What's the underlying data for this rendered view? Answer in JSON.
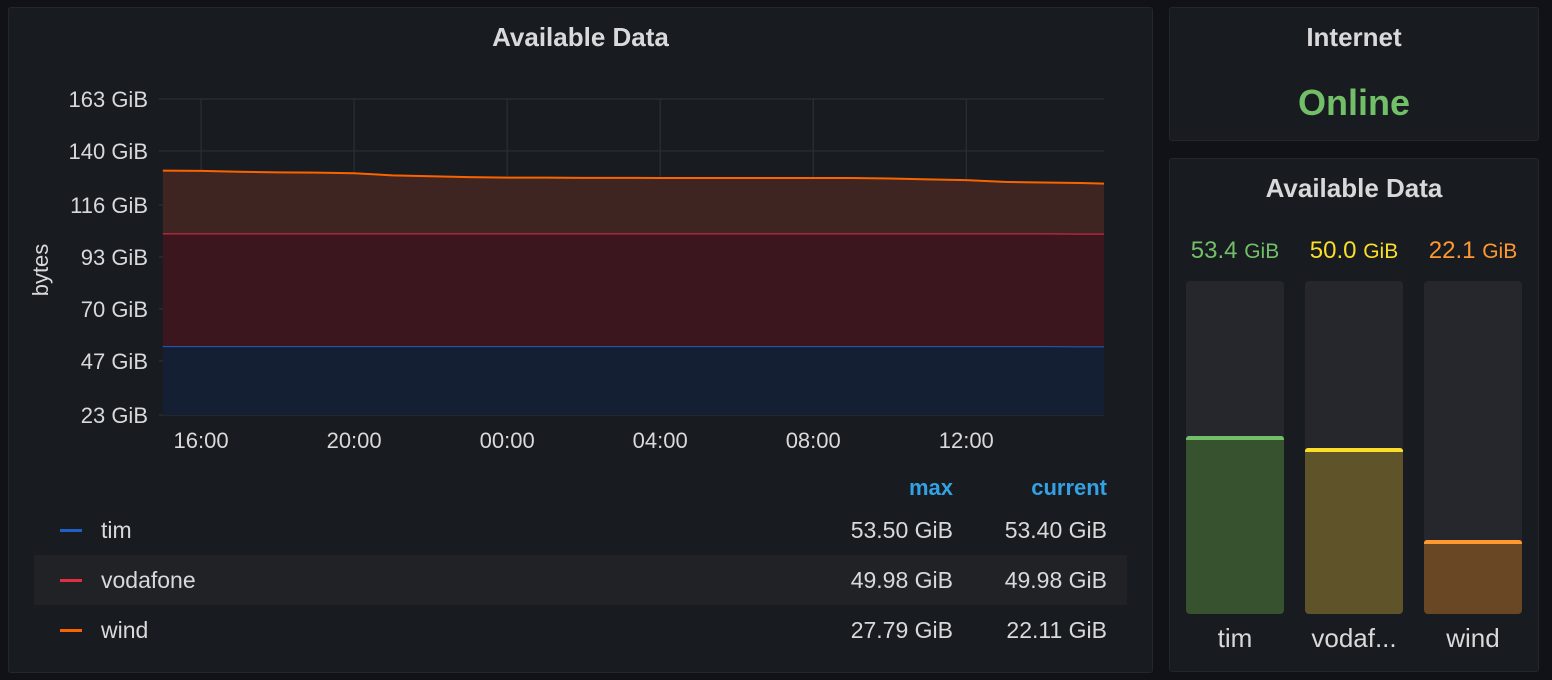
{
  "graph_panel": {
    "title": "Available Data",
    "legend": {
      "headers": {
        "max": "max",
        "current": "current"
      },
      "rows": [
        {
          "name": "tim",
          "max": "53.50 GiB",
          "current": "53.40 GiB",
          "color": "#1f60c4"
        },
        {
          "name": "vodafone",
          "max": "49.98 GiB",
          "current": "49.98 GiB",
          "color": "#e02f44"
        },
        {
          "name": "wind",
          "max": "27.79 GiB",
          "current": "22.11 GiB",
          "color": "#fa6400"
        }
      ]
    }
  },
  "chart_data": {
    "type": "area",
    "stacked": true,
    "title": "Available Data",
    "ylabel": "bytes",
    "xlabel": "",
    "ylim": [
      23,
      163
    ],
    "y_ticks": [
      "163 GiB",
      "140 GiB",
      "116 GiB",
      "93 GiB",
      "70 GiB",
      "47 GiB",
      "23 GiB"
    ],
    "y_tick_values": [
      163,
      140,
      116,
      93,
      70,
      47,
      23
    ],
    "x_ticks": [
      "16:00",
      "20:00",
      "00:00",
      "04:00",
      "08:00",
      "12:00"
    ],
    "x_tick_hours": [
      16,
      20,
      24,
      28,
      32,
      36
    ],
    "xlim_hours": [
      14.9,
      39.6
    ],
    "x_hours": [
      15,
      16,
      17,
      18,
      19,
      20,
      21,
      22,
      23,
      24,
      25,
      26,
      27,
      28,
      29,
      30,
      31,
      32,
      33,
      34,
      35,
      36,
      37,
      38,
      39,
      39.6
    ],
    "grid": true,
    "legend_placement": "bottom",
    "series": [
      {
        "name": "tim",
        "color": "#1f60c4",
        "values": [
          53.5,
          53.5,
          53.5,
          53.5,
          53.5,
          53.5,
          53.5,
          53.5,
          53.5,
          53.5,
          53.5,
          53.5,
          53.5,
          53.5,
          53.5,
          53.5,
          53.5,
          53.5,
          53.5,
          53.5,
          53.5,
          53.5,
          53.5,
          53.5,
          53.4,
          53.4
        ]
      },
      {
        "name": "vodafone",
        "color": "#e02f44",
        "values": [
          49.98,
          49.98,
          49.98,
          49.98,
          49.98,
          49.98,
          49.98,
          49.98,
          49.98,
          49.98,
          49.98,
          49.98,
          49.98,
          49.98,
          49.98,
          49.98,
          49.98,
          49.98,
          49.98,
          49.98,
          49.98,
          49.98,
          49.98,
          49.98,
          49.98,
          49.98
        ]
      },
      {
        "name": "wind",
        "color": "#fa6400",
        "values": [
          27.79,
          27.7,
          27.3,
          27.0,
          26.9,
          26.6,
          25.7,
          25.3,
          24.9,
          24.7,
          24.7,
          24.6,
          24.6,
          24.5,
          24.5,
          24.5,
          24.5,
          24.5,
          24.5,
          24.3,
          23.9,
          23.6,
          22.8,
          22.5,
          22.4,
          22.11
        ]
      }
    ]
  },
  "internet_panel": {
    "title": "Internet",
    "status": "Online",
    "status_color": "#73bf69"
  },
  "bar_panel": {
    "title": "Available Data",
    "max_value": 100,
    "bars": [
      {
        "name": "tim",
        "display_label": "tim",
        "value_number": "53.4",
        "unit": "GiB",
        "value": 53.4,
        "color": "#73bf69",
        "fill_color": "#37522f"
      },
      {
        "name": "vodafone",
        "display_label": "vodaf...",
        "value_number": "50.0",
        "unit": "GiB",
        "value": 50.0,
        "color": "#fade2a",
        "fill_color": "#5f532a"
      },
      {
        "name": "wind",
        "display_label": "wind",
        "value_number": "22.1",
        "unit": "GiB",
        "value": 22.1,
        "color": "#ff9830",
        "fill_color": "#6a4724"
      }
    ]
  }
}
